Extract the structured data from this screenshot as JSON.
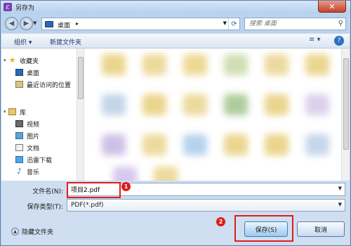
{
  "window": {
    "title": "另存为",
    "close_glyph": "✕"
  },
  "nav": {
    "back": "◀",
    "forward": "▶"
  },
  "address": {
    "location": "桌面",
    "separator": "▸"
  },
  "search": {
    "placeholder": "搜索 桌面",
    "icon": "search-icon"
  },
  "toolbar": {
    "organize_label": "组织 ▾",
    "new_folder_label": "新建文件夹",
    "view_glyph": "≡ ▾",
    "help_glyph": "?"
  },
  "sidebar": {
    "items": [
      {
        "label": "收藏夹",
        "icon": "star-icon"
      },
      {
        "label": "桌面",
        "icon": "desktop-icon"
      },
      {
        "label": "最近访问的位置",
        "icon": "recent-places-icon"
      },
      {
        "label": "库",
        "icon": "library-icon"
      },
      {
        "label": "视频",
        "icon": "video-icon"
      },
      {
        "label": "图片",
        "icon": "pictures-icon"
      },
      {
        "label": "文档",
        "icon": "documents-icon"
      },
      {
        "label": "迅雷下载",
        "icon": "thunder-download-icon"
      },
      {
        "label": "音乐",
        "icon": "music-icon"
      }
    ]
  },
  "form": {
    "filename_label": "文件名(N):",
    "filename_value": "项目2.pdf",
    "filetype_label": "保存类型(T):",
    "filetype_value": "PDF(*.pdf)",
    "badge1": "1",
    "badge2": "2"
  },
  "footer": {
    "hide_folders_label": "隐藏文件夹",
    "save_label": "保存(S)",
    "cancel_label": "取消"
  },
  "colors": {
    "annotation_red": "#e11c1c",
    "window_chrome": "#bcd3ee"
  }
}
